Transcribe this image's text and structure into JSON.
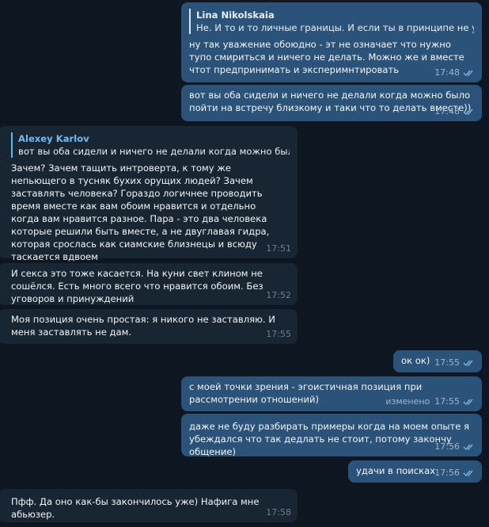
{
  "messages": [
    {
      "id": "m1",
      "dir": "out",
      "reply": {
        "name": "Lina Nikolskaia",
        "text": "Не. И то и то личные границы. И если ты в принципе не уваж..."
      },
      "text": "ну так уважение обоюдно - эт не означает что нужно тупо смириться и ничего не делать. Можно же и вместе чтот предпринимать и эксперимнтировать",
      "time": "17:48"
    },
    {
      "id": "m2",
      "dir": "out",
      "text": "вот вы оба сидели и ничего не делали когда можно было пойти на встречу близкому и таки что то делать вместе))",
      "time": "17:48"
    },
    {
      "id": "m3",
      "dir": "in",
      "reply": {
        "name": "Alexey Karlov",
        "text": "вот вы оба сидели и ничего не делали когда можно было пой..."
      },
      "text": "Зачем? Зачем тащить интроверта, к тому же непьющего в тусняк бухих орущих людей? Зачем заставлять человека? Гораздо логичнее проводить время вместе как вам обоим нравится и отдельно когда вам нравится разное. Пара - это два человека которые решили быть вместе, а не двуглавая гидра, которая срослась как сиамские близнецы и всюду таскается вдвоем",
      "time": "17:51"
    },
    {
      "id": "m4",
      "dir": "in",
      "text": "И секса это тоже касается. На куни свет клином не сошёлся. Есть много всего что нравится обоим. Без уговоров и принуждений",
      "time": "17:52"
    },
    {
      "id": "m5",
      "dir": "in",
      "text": "Моя позиция очень простая: я никого не заставляю. И меня заставлять не дам.",
      "time": "17:55"
    },
    {
      "id": "m6",
      "dir": "out",
      "text": "ок ок)",
      "time": "17:55"
    },
    {
      "id": "m7",
      "dir": "out",
      "text": "с моей точки зрения - эгоистичная позиция при рассмотрении отношений)",
      "edited": "изменено",
      "time": "17:55"
    },
    {
      "id": "m8",
      "dir": "out",
      "text": "даже не буду разбирать примеры когда на моем опыте я убеждался что так дедлать не стоит, потому закончу общение)",
      "time": "17:56"
    },
    {
      "id": "m9",
      "dir": "out",
      "text": "удачи в поисках",
      "time": "17:56"
    },
    {
      "id": "m10",
      "dir": "in",
      "text": "Пфф. Да оно как-бы закончилось уже) Нафига мне абьюзер.",
      "time": "17:58"
    }
  ]
}
